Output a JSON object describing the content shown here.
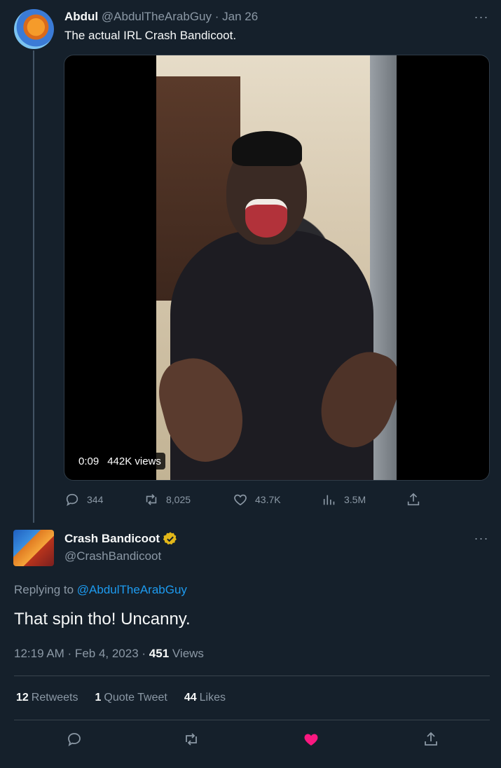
{
  "colors": {
    "background": "#15202b",
    "text": "#f7f9f9",
    "muted": "#8b98a5",
    "link": "#1d9bf0",
    "like_active": "#f91880",
    "verified": "#e2b719"
  },
  "tweet1": {
    "author_name": "Abdul",
    "author_handle": "@AbdulTheArabGuy",
    "date": "Jan 26",
    "text": "The actual IRL Crash Bandicoot.",
    "video": {
      "duration": "0:09",
      "views": "442K views"
    },
    "actions": {
      "replies": "344",
      "retweets": "8,025",
      "likes": "43.7K",
      "views": "3.5M"
    },
    "icons": [
      "reply-icon",
      "retweet-icon",
      "like-icon",
      "views-icon",
      "share-icon",
      "more-icon"
    ]
  },
  "tweet2": {
    "author_name": "Crash Bandicoot",
    "author_handle": "@CrashBandicoot",
    "replying_prefix": "Replying to",
    "replying_to": "@AbdulTheArabGuy",
    "text": "That spin tho! Uncanny.",
    "time_date": "12:19 AM · Feb 4, 2023 · ",
    "view_count": "451",
    "view_label": " Views",
    "stats": {
      "retweets_count": "12",
      "retweets_label": "Retweets",
      "quotes_count": "1",
      "quotes_label": "Quote Tweet",
      "likes_count": "44",
      "likes_label": "Likes"
    },
    "liked": true
  }
}
